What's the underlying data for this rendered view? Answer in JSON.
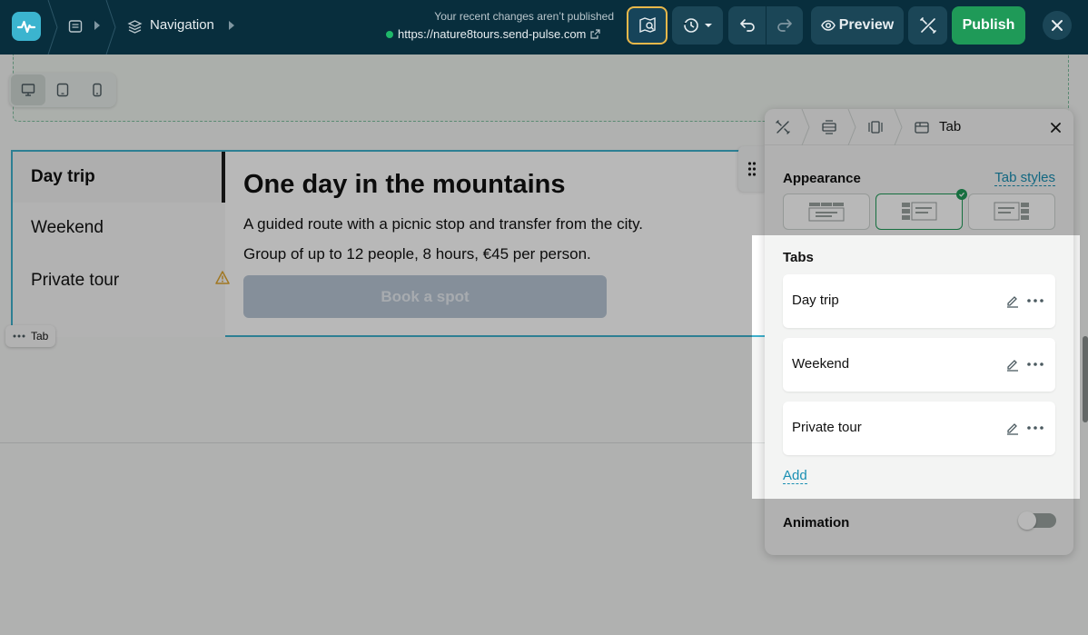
{
  "topbar": {
    "breadcrumb_label": "Navigation",
    "unpublished_message": "Your recent changes aren’t published",
    "site_url": "https://nature8tours.send-pulse.com",
    "preview_label": "Preview",
    "publish_label": "Publish",
    "icons": [
      "logo-icon",
      "page-icon",
      "layers-icon",
      "review-icon",
      "history-icon",
      "undo-icon",
      "redo-icon",
      "eye-icon",
      "tools-icon",
      "close-icon"
    ]
  },
  "device_switcher": {
    "options": [
      "desktop",
      "tablet",
      "mobile"
    ],
    "selected": "desktop"
  },
  "tabs_widget": {
    "tabs": [
      {
        "label": "Day trip",
        "active": true
      },
      {
        "label": "Weekend",
        "active": false
      },
      {
        "label": "Private tour",
        "active": false
      }
    ],
    "content": {
      "title": "One day in the mountains",
      "line1": "A guided route with a picnic stop and transfer from the city.",
      "line2": "Group of up to 12 people, 8 hours, €45 per person.",
      "button_label": "Book a spot"
    },
    "chip_label": "Tab"
  },
  "panel": {
    "title": "Tab",
    "appearance_label": "Appearance",
    "tab_styles_link": "Tab styles",
    "layout_selected_index": 1,
    "tabs_label": "Tabs",
    "tab_rows": [
      {
        "label": "Day trip"
      },
      {
        "label": "Weekend"
      },
      {
        "label": "Private tour"
      }
    ],
    "add_label": "Add",
    "animation_label": "Animation",
    "animation_enabled": false
  },
  "colors": {
    "topbar_bg": "#082e3d",
    "publish_green": "#1f9a58",
    "accent_blue": "#1a8fb3",
    "review_outline": "#e9b84a"
  }
}
